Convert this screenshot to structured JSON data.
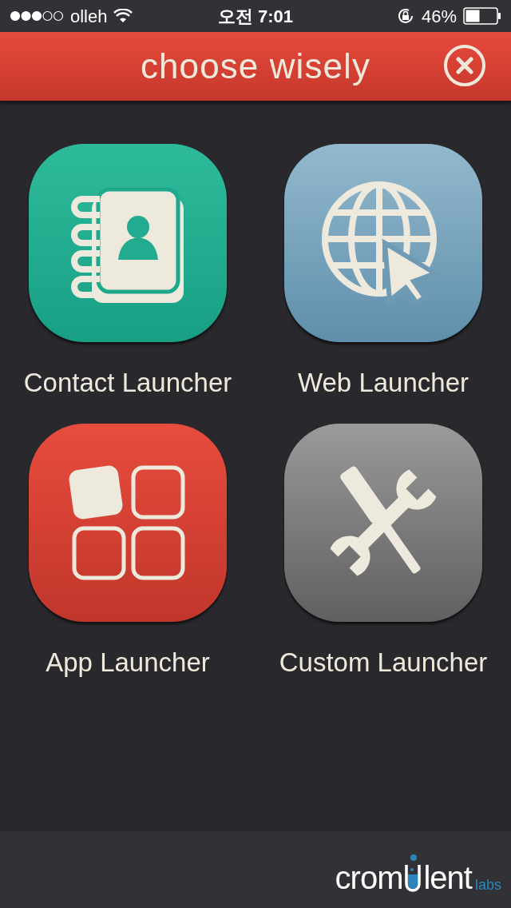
{
  "status_bar": {
    "carrier": "olleh",
    "time": "오전 7:01",
    "battery": "46%"
  },
  "header": {
    "title": "choose wisely"
  },
  "launchers": [
    {
      "kind": "contact",
      "label": "Contact Launcher"
    },
    {
      "kind": "web",
      "label": "Web Launcher"
    },
    {
      "kind": "app",
      "label": "App Launcher"
    },
    {
      "kind": "custom",
      "label": "Custom Launcher"
    }
  ],
  "footer": {
    "logo": {
      "before": "crom",
      "after": "lent",
      "suffix": "labs"
    }
  }
}
